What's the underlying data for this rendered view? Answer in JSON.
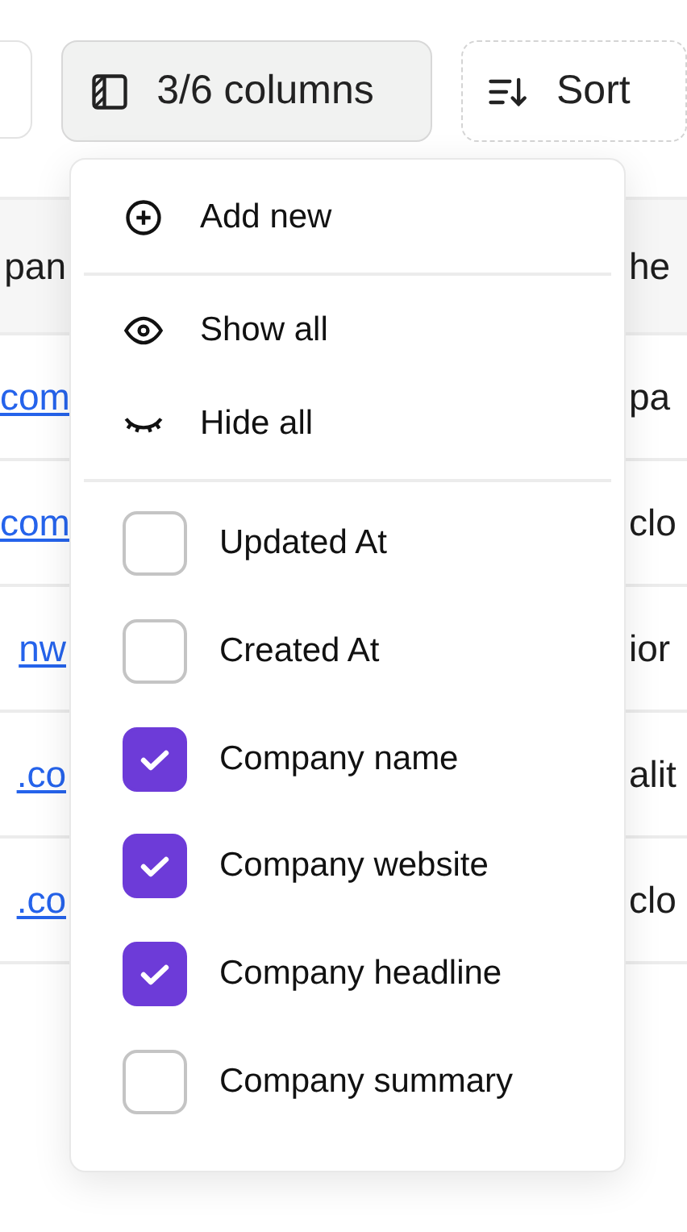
{
  "toolbar": {
    "columns_button": {
      "label": "3/6 columns",
      "expanded": true
    },
    "sort_button": {
      "label": "Sort"
    }
  },
  "table": {
    "header": {
      "column_1": "pan",
      "column_2": "he"
    },
    "rows": [
      {
        "column_1": "com",
        "column_2": "pa"
      },
      {
        "column_1": "com",
        "column_2": "clo"
      },
      {
        "column_1": "nw",
        "column_2": "ior"
      },
      {
        "column_1": ".co",
        "column_2": "alit"
      },
      {
        "column_1": ".co",
        "column_2": "clo"
      }
    ]
  },
  "menu": {
    "primary": [
      {
        "kind": "add",
        "label": "Add new"
      }
    ],
    "visibility": [
      {
        "kind": "show",
        "label": "Show all"
      },
      {
        "kind": "hide",
        "label": "Hide all"
      }
    ],
    "columns": [
      {
        "label": "Updated At",
        "checked": false
      },
      {
        "label": "Created At",
        "checked": false
      },
      {
        "label": "Company name",
        "checked": true
      },
      {
        "label": "Company website",
        "checked": true
      },
      {
        "label": "Company headline",
        "checked": true
      },
      {
        "label": "Company summary",
        "checked": false
      }
    ]
  }
}
